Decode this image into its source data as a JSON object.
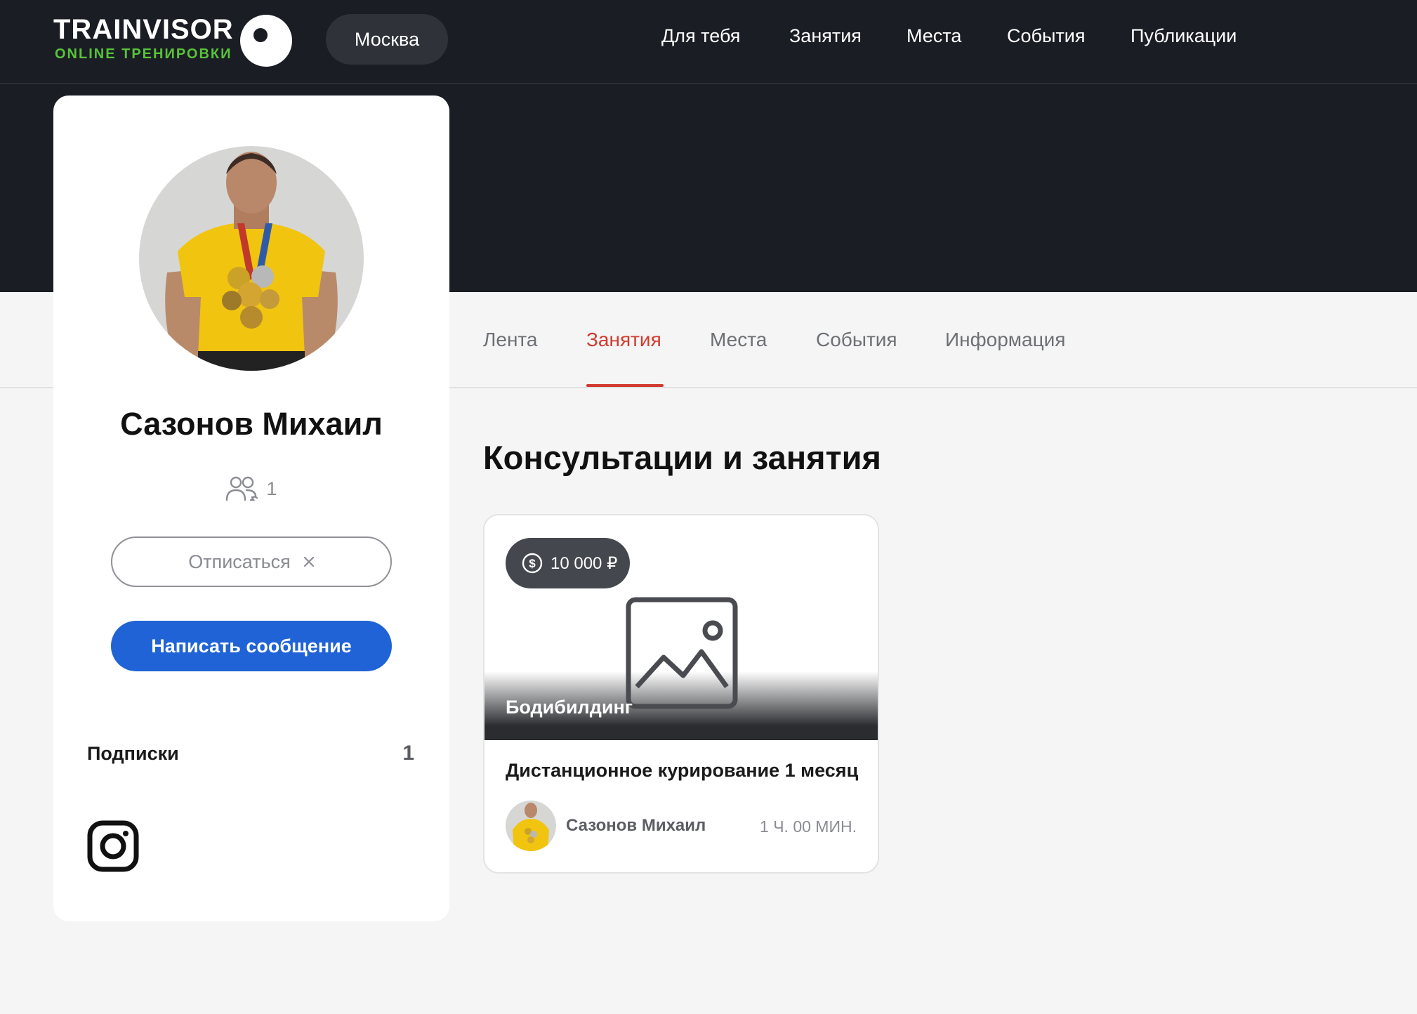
{
  "brand": {
    "name": "TRAINVISOR",
    "tagline": "ONLINE ТРЕНИРОВКИ",
    "tagline_color": "#58c33a"
  },
  "header": {
    "city": "Москва",
    "nav": [
      {
        "label": "Для тебя"
      },
      {
        "label": "Занятия"
      },
      {
        "label": "Места"
      },
      {
        "label": "События"
      },
      {
        "label": "Публикации"
      }
    ]
  },
  "profile": {
    "name": "Сазонов Михаил",
    "avatar": "user-avatar-photo",
    "followers_icon": "users-icon",
    "followers_count": "1",
    "unsubscribe_label": "Отписаться",
    "unsubscribe_icon": "close-icon",
    "message_label": "Написать сообщение",
    "message_button_color": "#1f63d6",
    "subscriptions_label": "Подписки",
    "subscriptions_count": "1",
    "social_icon": "instagram-icon"
  },
  "tabs": {
    "items": [
      {
        "label": "Лента"
      },
      {
        "label": "Занятия"
      },
      {
        "label": "Места"
      },
      {
        "label": "События"
      },
      {
        "label": "Информация"
      }
    ],
    "active": "Занятия",
    "active_color": "#d23a2f"
  },
  "section": {
    "title": "Консультации и занятия"
  },
  "classes": [
    {
      "price": "10 000 ₽",
      "price_icon": "dollar-circle-icon",
      "image_icon": "image-placeholder-icon",
      "category": "Бодибилдинг",
      "title": "Дистанционное курирование 1 месяц",
      "author": "Сазонов Михаил",
      "duration": "1 Ч. 00 МИН."
    }
  ]
}
